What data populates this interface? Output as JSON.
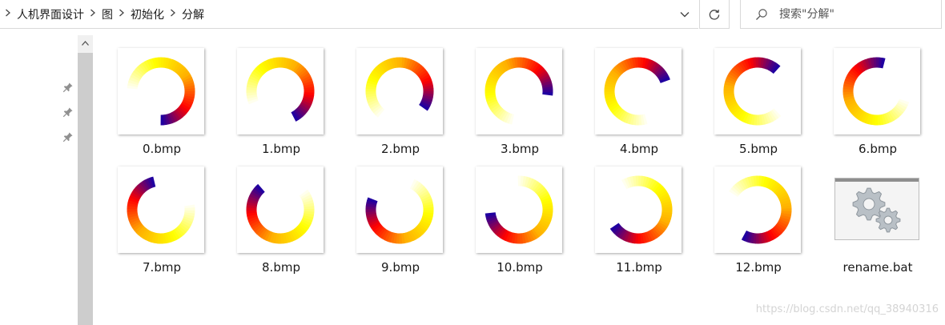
{
  "breadcrumb": [
    "人机界面设计",
    "图",
    "初始化",
    "分解"
  ],
  "search": {
    "placeholder": "搜索\"分解\""
  },
  "colors": {
    "ring_stops": [
      "#ffffff",
      "#ffff00",
      "#ffb000",
      "#ff0000",
      "#2000a0"
    ]
  },
  "files": [
    {
      "name": "0.bmp",
      "type": "image",
      "rotation_deg": 0
    },
    {
      "name": "1.bmp",
      "type": "image",
      "rotation_deg": -27.7
    },
    {
      "name": "2.bmp",
      "type": "image",
      "rotation_deg": -55.4
    },
    {
      "name": "3.bmp",
      "type": "image",
      "rotation_deg": -83.1
    },
    {
      "name": "4.bmp",
      "type": "image",
      "rotation_deg": -110.8
    },
    {
      "name": "5.bmp",
      "type": "image",
      "rotation_deg": -138.5
    },
    {
      "name": "6.bmp",
      "type": "image",
      "rotation_deg": -166.2
    },
    {
      "name": "7.bmp",
      "type": "image",
      "rotation_deg": -193.8
    },
    {
      "name": "8.bmp",
      "type": "image",
      "rotation_deg": -221.5
    },
    {
      "name": "9.bmp",
      "type": "image",
      "rotation_deg": -249.2
    },
    {
      "name": "10.bmp",
      "type": "image",
      "rotation_deg": -276.9
    },
    {
      "name": "11.bmp",
      "type": "image",
      "rotation_deg": -304.6
    },
    {
      "name": "12.bmp",
      "type": "image",
      "rotation_deg": -332.3
    },
    {
      "name": "rename.bat",
      "type": "batch",
      "icon": "gears-icon"
    }
  ],
  "watermark": "https://blog.csdn.net/qq_38940316"
}
